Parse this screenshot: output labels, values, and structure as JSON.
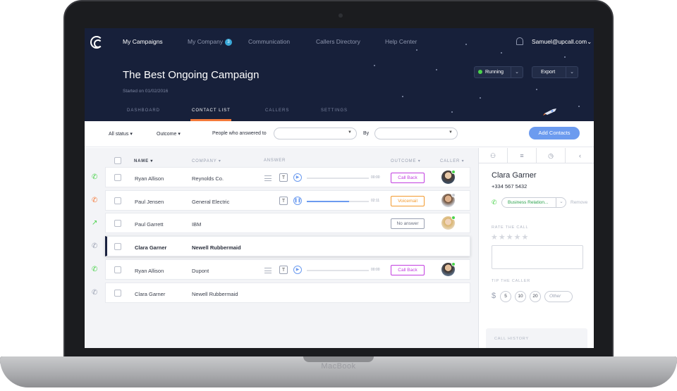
{
  "device_label": "MacBook",
  "nav": {
    "items": [
      "My Campaigns",
      "My Company",
      "Communication",
      "Callers Directory",
      "Help Center"
    ],
    "company_badge": "3",
    "user": "Samuel@upcall.com"
  },
  "campaign": {
    "title": "The Best Ongoing  Campaign",
    "started": "Started on 01/02/2016",
    "status": "Running",
    "export": "Export"
  },
  "tabs": [
    "DASHBOARD",
    "CONTACT LIST",
    "CALLERS",
    "SETTINGS"
  ],
  "filters": {
    "status": "All status",
    "outcome": "Outcome",
    "answered_label": "People who answered to",
    "by_label": "By",
    "add_button": "Add Contacts"
  },
  "table": {
    "headers": [
      "NAME",
      "COMPANY",
      "ANSWER",
      "OUTCOME",
      "CALLER"
    ],
    "rows": [
      {
        "name": "Ryan Allison",
        "company": "Reynolds Co.",
        "duration": "00:00",
        "outcome": "Call Back",
        "progress": 0
      },
      {
        "name": "Paul Jensen",
        "company": "General Electric",
        "duration": "02:11",
        "outcome": "Voicemail",
        "progress": 0.68
      },
      {
        "name": "Paul Garrett",
        "company": "IBM",
        "duration": "",
        "outcome": "No answer",
        "progress": 0
      },
      {
        "name": "Clara Garner",
        "company": "Newell Rubbermaid",
        "duration": "",
        "outcome": "",
        "progress": 0
      },
      {
        "name": "Ryan Allison",
        "company": "Dupont",
        "duration": "00:00",
        "outcome": "Call Back",
        "progress": 0
      },
      {
        "name": "Clara Garner",
        "company": "Newell Rubbermaid",
        "duration": "",
        "outcome": "",
        "progress": 0
      }
    ]
  },
  "contact": {
    "name": "Clara Garner",
    "phone": "+334 567 5432",
    "relation": "Business Relation...",
    "remove": "Remove",
    "rate_label": "RATE THE CALL",
    "tip_label": "TIP THE CALLER",
    "tip_currency": "$",
    "tips": [
      "5",
      "10",
      "20"
    ],
    "tip_other": "Other",
    "history_label": "CALL HISTORY"
  },
  "colors": {
    "header_bg": "#17203a",
    "accent_orange": "#f47a3a",
    "primary_blue": "#6c9bef",
    "callback_purple": "#c23ee0",
    "voicemail_orange": "#f39a2e",
    "green": "#4ad34b"
  }
}
